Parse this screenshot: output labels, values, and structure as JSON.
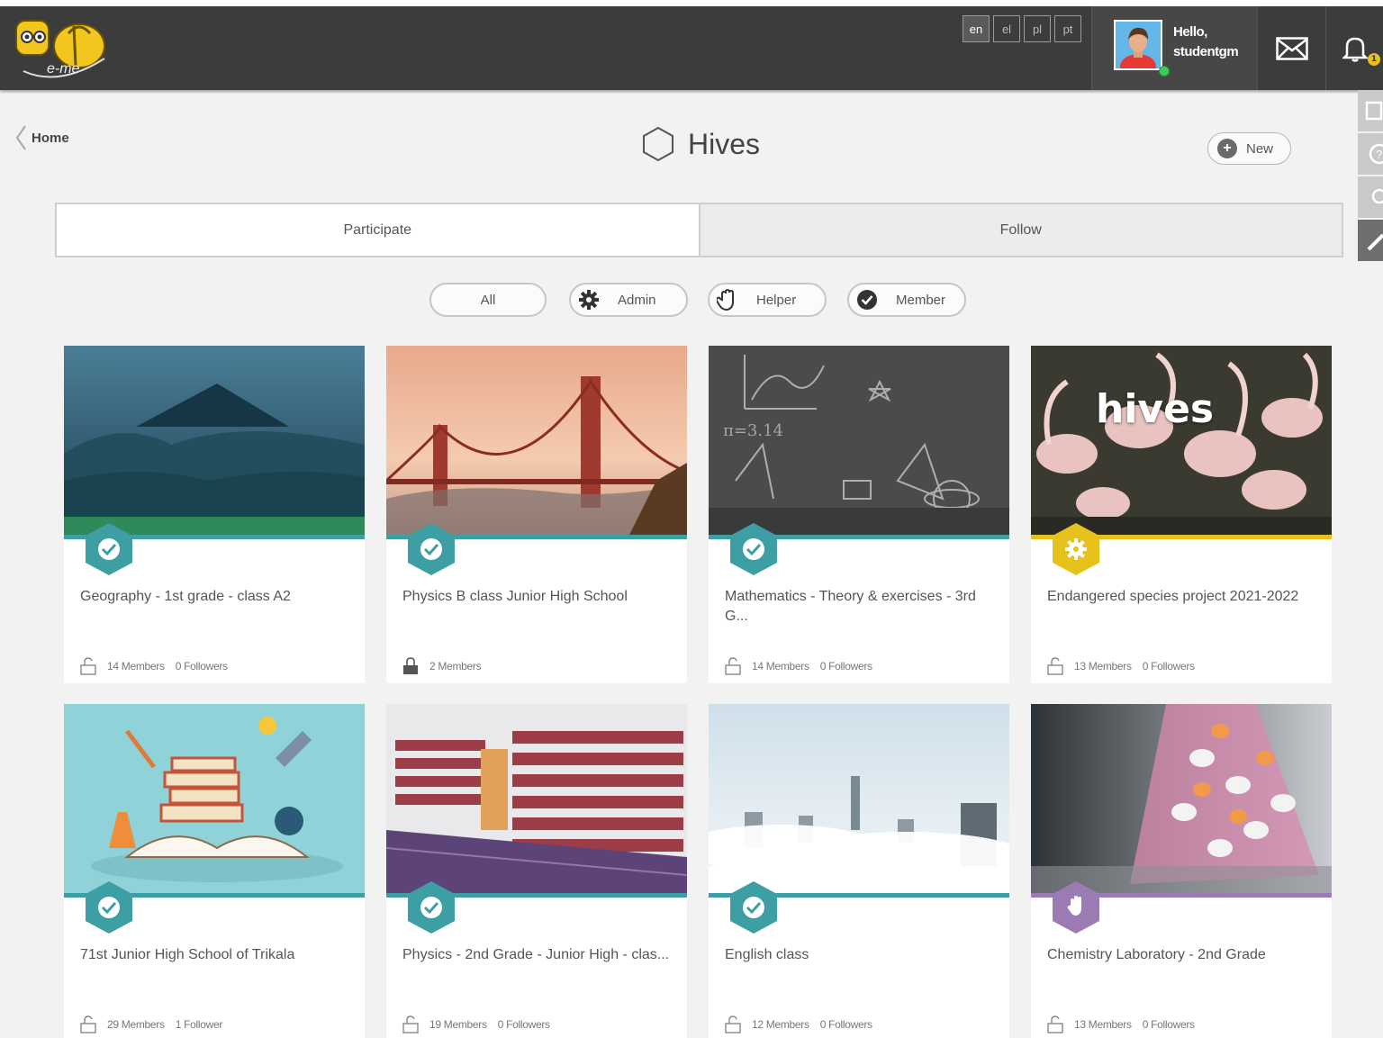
{
  "header": {
    "logo_text": "e-me",
    "languages": [
      "en",
      "el",
      "pl",
      "pt"
    ],
    "active_language": "en",
    "greeting_line1": "Hello,",
    "greeting_line2": "studentgm",
    "notification_count": "1"
  },
  "breadcrumb": {
    "home_label": "Home"
  },
  "page": {
    "title": "Hives",
    "new_button_label": "New"
  },
  "tabs": [
    {
      "label": "Participate",
      "active": true
    },
    {
      "label": "Follow",
      "active": false
    }
  ],
  "filters": [
    {
      "label": "All",
      "icon": "none"
    },
    {
      "label": "Admin",
      "icon": "gear-icon"
    },
    {
      "label": "Helper",
      "icon": "hand-icon"
    },
    {
      "label": "Member",
      "icon": "check-circle-icon"
    }
  ],
  "colors": {
    "member_teal": "#3d9ea3",
    "admin_yellow": "#e7c11c",
    "helper_purple": "#9c7ab4",
    "topbar": "#3c3c3c"
  },
  "hives": [
    {
      "title": "Geography - 1st grade - class A2",
      "members": "14 Members",
      "followers": "0 Followers",
      "role": "member",
      "lock": "open",
      "image": "mountain-landscape",
      "overlay": ""
    },
    {
      "title": "Physics B class Junior High School",
      "members": "2 Members",
      "followers": "",
      "role": "member",
      "lock": "closed",
      "image": "golden-gate-bridge",
      "overlay": ""
    },
    {
      "title": "Mathematics - Theory & exercises - 3rd G...",
      "members": "14 Members",
      "followers": "0 Followers",
      "role": "member",
      "lock": "open",
      "image": "chalkboard-math",
      "overlay": ""
    },
    {
      "title": "Endangered species project 2021-2022",
      "members": "13 Members",
      "followers": "0 Followers",
      "role": "admin",
      "lock": "open",
      "image": "flamingos",
      "overlay": "hives"
    },
    {
      "title": "71st Junior High School of Trikala",
      "members": "29 Members",
      "followers": "1 Follower",
      "role": "member",
      "lock": "open",
      "image": "school-books",
      "overlay": ""
    },
    {
      "title": "Physics - 2nd Grade - Junior High - clas...",
      "members": "19 Members",
      "followers": "0 Followers",
      "role": "member",
      "lock": "open",
      "image": "library-shelves",
      "overlay": ""
    },
    {
      "title": "English class",
      "members": "12 Members",
      "followers": "0 Followers",
      "role": "member",
      "lock": "open",
      "image": "city-clouds",
      "overlay": ""
    },
    {
      "title": "Chemistry Laboratory - 2nd Grade",
      "members": "13 Members",
      "followers": "0 Followers",
      "role": "helper",
      "lock": "open",
      "image": "chemistry-flask",
      "overlay": ""
    }
  ]
}
